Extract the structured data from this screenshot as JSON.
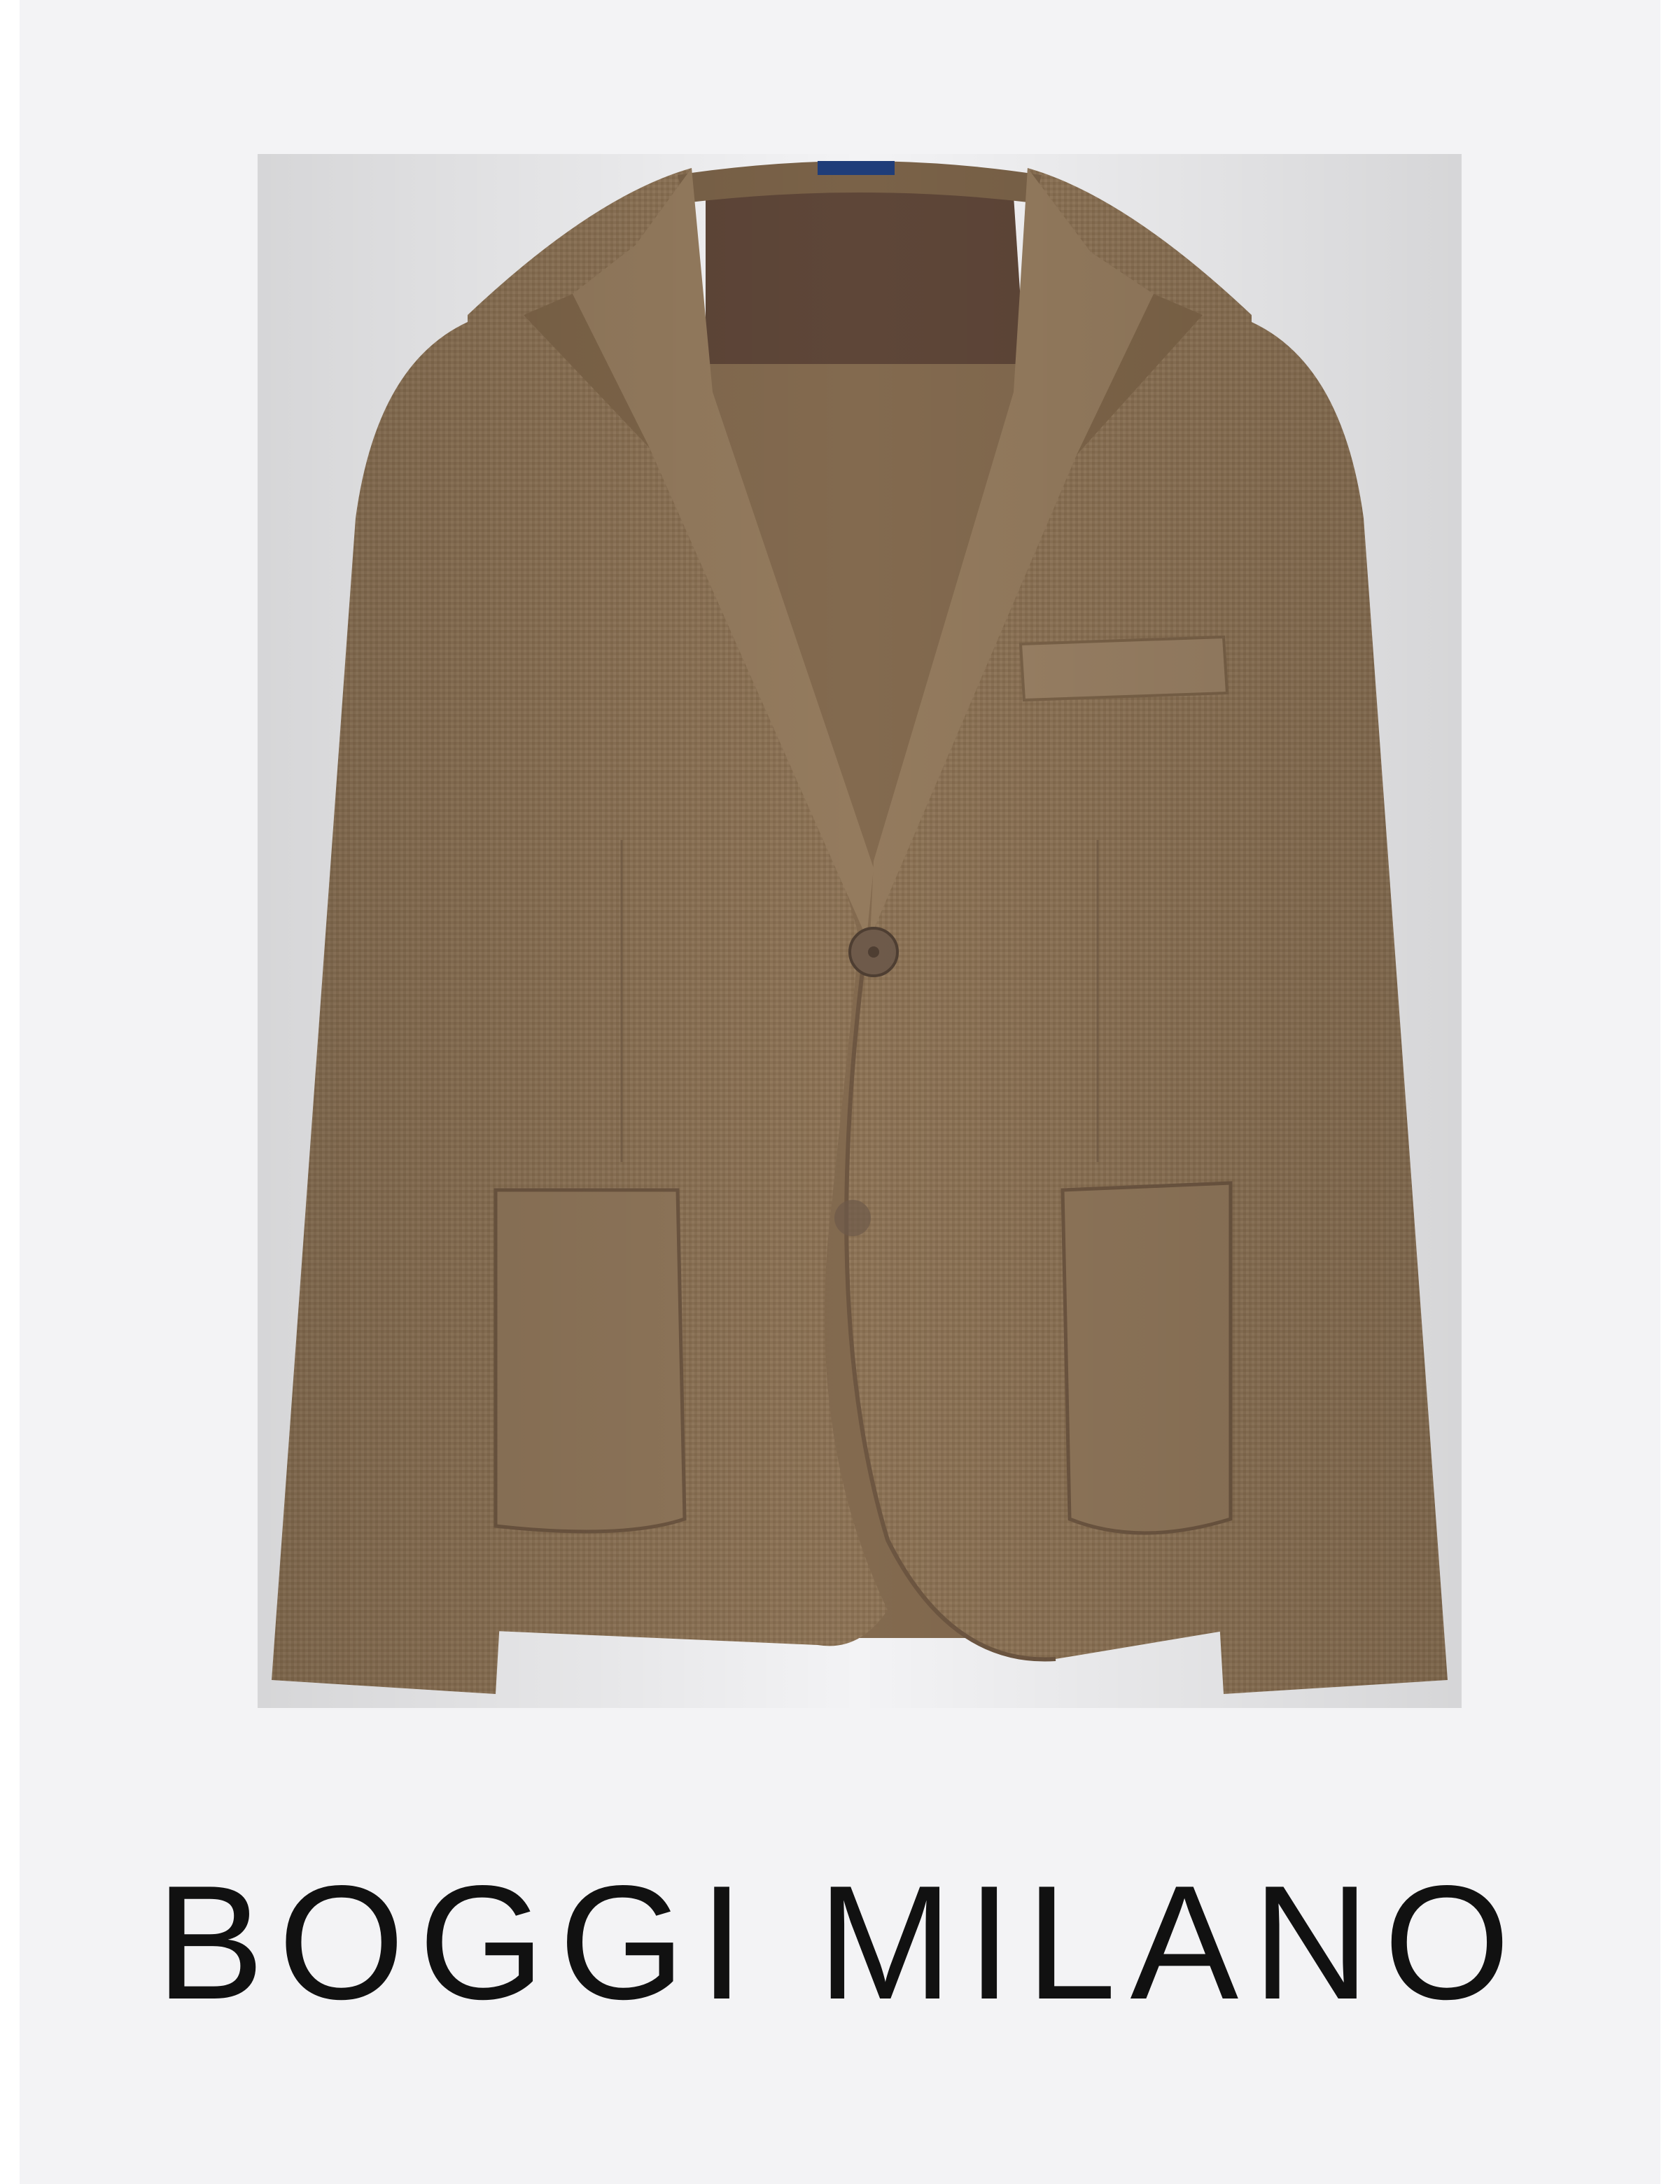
{
  "product": {
    "image_icon": "blazer-icon",
    "brand": "BOGGI MILANO"
  },
  "colors": {
    "background": "#f3f3f5",
    "jacket": "#8b7256",
    "lining": "#5e4638",
    "text": "#111111"
  }
}
